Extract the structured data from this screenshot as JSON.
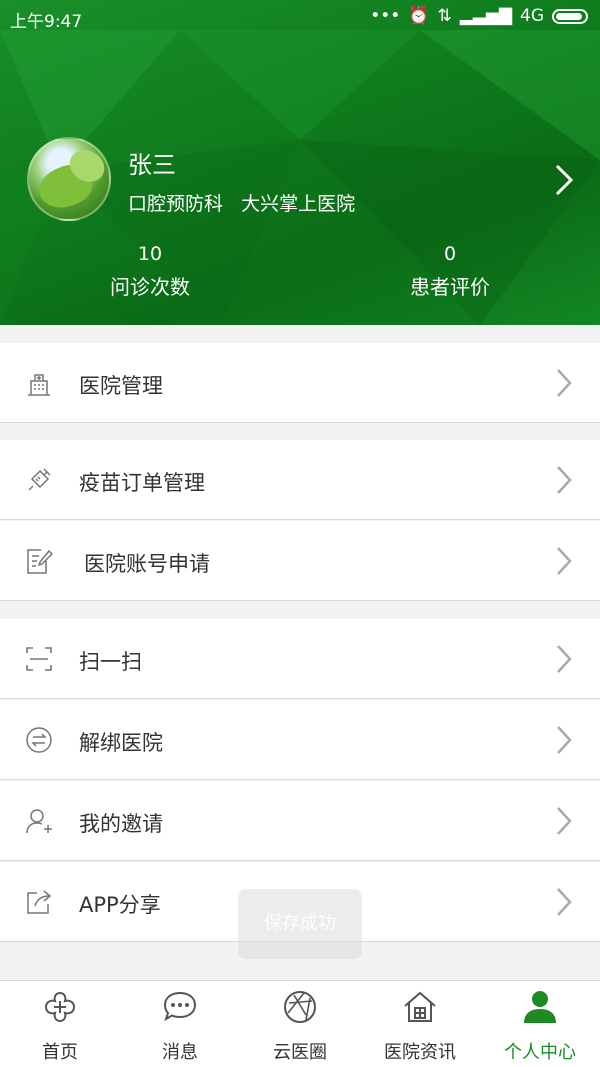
{
  "status_bar": {
    "time": "上午9:47",
    "signal": "4G"
  },
  "profile": {
    "name": "张三",
    "department": "口腔预防科",
    "hospital": "大兴掌上医院",
    "stats": [
      {
        "value": "10",
        "label": "问诊次数"
      },
      {
        "value": "0",
        "label": "患者评价"
      }
    ]
  },
  "menu": {
    "hospital_management": "医院管理",
    "vaccine_orders": "疫苗订单管理",
    "account_application": "医院账号申请",
    "scan": "扫一扫",
    "unbind_hospital": "解绑医院",
    "my_invitations": "我的邀请",
    "app_share": "APP分享"
  },
  "toast": "保存成功",
  "tabs": [
    {
      "label": "首页",
      "icon": "home-clover-icon"
    },
    {
      "label": "消息",
      "icon": "chat-bubble-icon"
    },
    {
      "label": "云医圈",
      "icon": "aperture-icon"
    },
    {
      "label": "医院资讯",
      "icon": "hospital-house-icon"
    },
    {
      "label": "个人中心",
      "icon": "person-icon",
      "active": true
    }
  ],
  "colors": {
    "brand_green": "#1e8a25",
    "header_green": "#0e7a1c"
  }
}
